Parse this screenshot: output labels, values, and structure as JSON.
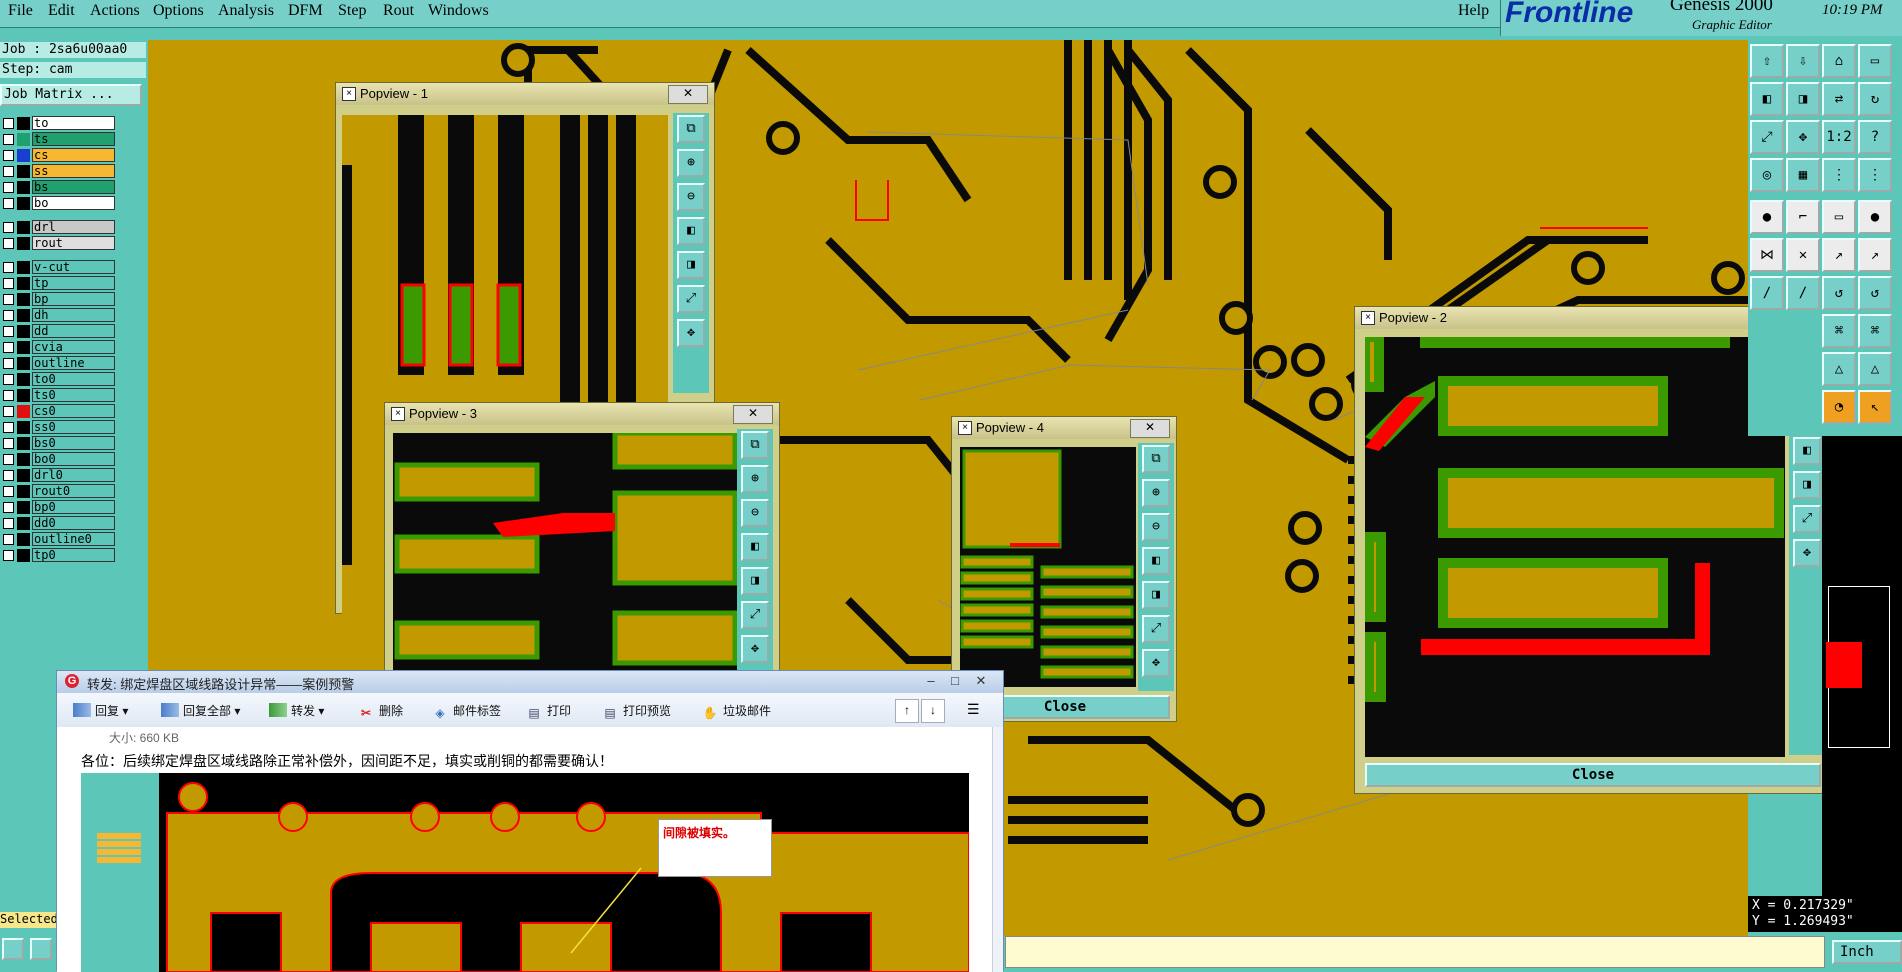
{
  "menubar": {
    "items": [
      "File",
      "Edit",
      "Actions",
      "Options",
      "Analysis",
      "DFM",
      "Step",
      "Rout",
      "Windows"
    ],
    "help": "Help",
    "logo": "Frontline",
    "app_name": "Genesis 2000",
    "subtitle": "Graphic Editor",
    "clock": "10:19 PM"
  },
  "left": {
    "job": "Job : 2sa6u00aa0",
    "step": "Step: cam",
    "job_matrix": "Job Matrix ...",
    "layers": [
      {
        "name": "to",
        "bg": "#ffffff"
      },
      {
        "name": "ts",
        "bg": "#1fa06e"
      },
      {
        "name": "cs",
        "bg": "#f6b832",
        "active": true
      },
      {
        "name": "ss",
        "bg": "#f6b832"
      },
      {
        "name": "bs",
        "bg": "#1fa06e"
      },
      {
        "name": "bo",
        "bg": "#ffffff"
      },
      {
        "name": "drl",
        "bg": "#c8c8c8"
      },
      {
        "name": "rout",
        "bg": "#dedede"
      },
      {
        "name": "v-cut",
        "bg": "#5cc7b8"
      },
      {
        "name": "tp",
        "bg": "#5cc7b8"
      },
      {
        "name": "bp",
        "bg": "#5cc7b8"
      },
      {
        "name": "dh",
        "bg": "#5cc7b8"
      },
      {
        "name": "dd",
        "bg": "#5cc7b8"
      },
      {
        "name": "cvia",
        "bg": "#5cc7b8"
      },
      {
        "name": "outline",
        "bg": "#5cc7b8"
      },
      {
        "name": "to0",
        "bg": "#5cc7b8"
      },
      {
        "name": "ts0",
        "bg": "#5cc7b8"
      },
      {
        "name": "cs0",
        "bg": "#5cc7b8"
      },
      {
        "name": "ss0",
        "bg": "#5cc7b8"
      },
      {
        "name": "bs0",
        "bg": "#5cc7b8"
      },
      {
        "name": "bo0",
        "bg": "#5cc7b8"
      },
      {
        "name": "drl0",
        "bg": "#5cc7b8"
      },
      {
        "name": "rout0",
        "bg": "#5cc7b8"
      },
      {
        "name": "bp0",
        "bg": "#5cc7b8"
      },
      {
        "name": "dd0",
        "bg": "#5cc7b8"
      },
      {
        "name": "outline0",
        "bg": "#5cc7b8"
      },
      {
        "name": "tp0",
        "bg": "#5cc7b8"
      }
    ],
    "selected": "Selected"
  },
  "popups": {
    "p1": {
      "title": "Popview - 1"
    },
    "p2": {
      "title": "Popview - 2",
      "close": "Close"
    },
    "p3": {
      "title": "Popview - 3"
    },
    "p4": {
      "title": "Popview - 4",
      "close": "Close"
    }
  },
  "coords": {
    "x": "X = 0.217329\"",
    "y": "Y = 1.269493\""
  },
  "units": "Inch",
  "email": {
    "title": "转发: 绑定焊盘区域线路设计异常——案例预警",
    "toolbar": [
      "回复",
      "回复全部",
      "转发",
      "删除",
      "邮件标签",
      "打印",
      "打印预览",
      "垃圾邮件"
    ],
    "size": "大小: 660 KB",
    "body": "各位：后续绑定焊盘区域线路除正常补偿外，因间距不足，填实或削铜的都需要确认！",
    "note": "间隙被填实。"
  },
  "colors": {
    "board": "#c29a00",
    "trace": "#0a0a0a",
    "teal": "#5cc7b8",
    "clearance": "#ff0000",
    "mask": "#3a9a00"
  }
}
